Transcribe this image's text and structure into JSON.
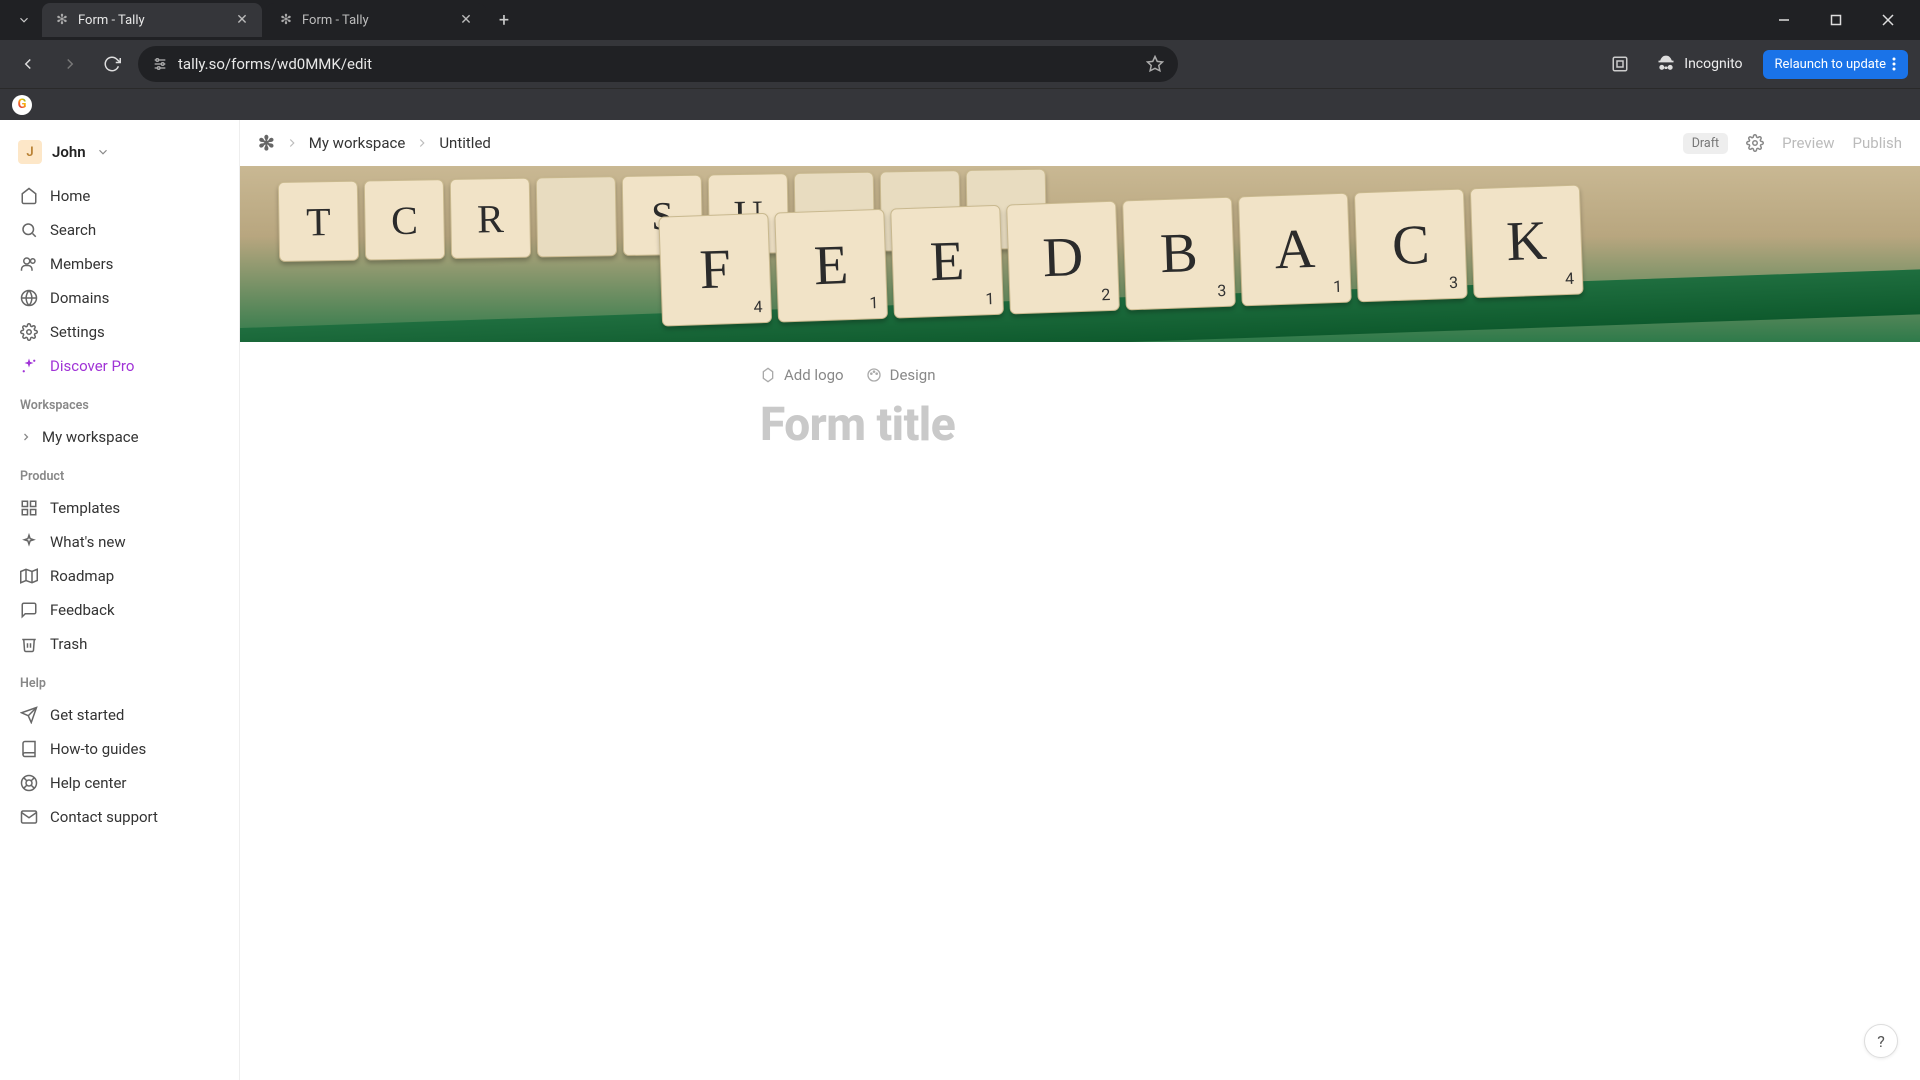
{
  "browser": {
    "tabs": [
      {
        "title": "Form - Tally",
        "active": true
      },
      {
        "title": "Form - Tally",
        "active": false
      }
    ],
    "url": "tally.so/forms/wd0MMK/edit",
    "incognito_label": "Incognito",
    "relaunch_label": "Relaunch to update"
  },
  "user": {
    "initial": "J",
    "name": "John"
  },
  "sidebar": {
    "nav": [
      {
        "icon": "home",
        "label": "Home"
      },
      {
        "icon": "search",
        "label": "Search"
      },
      {
        "icon": "members",
        "label": "Members"
      },
      {
        "icon": "globe",
        "label": "Domains"
      },
      {
        "icon": "gear",
        "label": "Settings"
      },
      {
        "icon": "sparkle",
        "label": "Discover Pro",
        "pro": true
      }
    ],
    "workspaces_label": "Workspaces",
    "workspace": "My workspace",
    "product_label": "Product",
    "product": [
      {
        "icon": "templates",
        "label": "Templates"
      },
      {
        "icon": "sparkle",
        "label": "What's new"
      },
      {
        "icon": "map",
        "label": "Roadmap"
      },
      {
        "icon": "chat",
        "label": "Feedback"
      },
      {
        "icon": "trash",
        "label": "Trash"
      }
    ],
    "help_label": "Help",
    "help": [
      {
        "icon": "send",
        "label": "Get started"
      },
      {
        "icon": "book",
        "label": "How-to guides"
      },
      {
        "icon": "life",
        "label": "Help center"
      },
      {
        "icon": "mail",
        "label": "Contact support"
      }
    ]
  },
  "breadcrumb": {
    "workspace": "My workspace",
    "page": "Untitled"
  },
  "topbar": {
    "draft": "Draft",
    "preview": "Preview",
    "publish": "Publish"
  },
  "editor": {
    "add_logo": "Add logo",
    "design": "Design",
    "title_placeholder": "Form title"
  },
  "cover_tiles": [
    "F",
    "E",
    "E",
    "D",
    "B",
    "A",
    "C",
    "K"
  ],
  "cover_subs": [
    "4",
    "1",
    "1",
    "2",
    "3",
    "1",
    "3",
    "4"
  ],
  "cover_tiles_top": [
    "T",
    "C",
    "R",
    "",
    "S",
    "U",
    "",
    "",
    ""
  ]
}
